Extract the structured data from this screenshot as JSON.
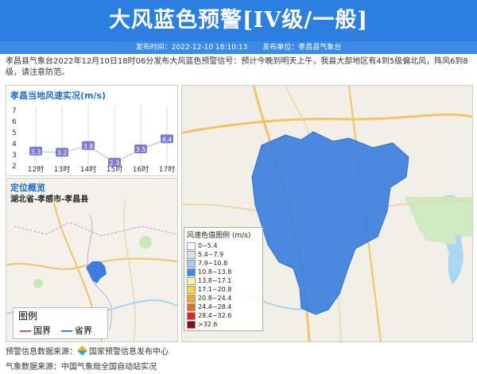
{
  "header": {
    "title": "大风蓝色预警[IV级/一般]",
    "publish_time_label": "发布时间：2022-12-10 18:10:13",
    "publisher_label": "发布单位：孝昌县气象台"
  },
  "description": "孝昌县气象台2022年12月10日18时06分发布大风蓝色预警信号：预计今晚到明天上午，我县大部地区有4到5级偏北风，阵风6到8级，请注意防范。",
  "wind_panel": {
    "title": "孝昌当地风速实况(m/s)",
    "y_ticks": [
      "7",
      "6",
      "5",
      "4",
      "3",
      "2"
    ],
    "labels": [
      "3.3",
      "3.2",
      "3.8",
      "2.3",
      "3.5",
      "4.4"
    ],
    "hours": [
      "12时",
      "13时",
      "14时",
      "15时",
      "16时",
      "17时"
    ]
  },
  "chart_data": {
    "type": "line",
    "title": "孝昌当地风速实况(m/s)",
    "categories": [
      "12时",
      "13时",
      "14时",
      "15时",
      "16时",
      "17时"
    ],
    "values": [
      3.3,
      3.2,
      3.8,
      2.3,
      3.5,
      4.4
    ],
    "ylim": [
      2,
      7
    ]
  },
  "location_panel": {
    "title": "定位概览",
    "region": "湖北省-孝感市-孝昌县",
    "legend_title": "图例",
    "legend_items": [
      "国界",
      "省界"
    ]
  },
  "main_map": {
    "legend_title": "风速色值图例 (m/s)",
    "legend": [
      {
        "label": "0~5.4",
        "color": "#ffffff"
      },
      {
        "label": "5.4~7.9",
        "color": "#cfe6f8"
      },
      {
        "label": "7.9~10.8",
        "color": "#9fcdf2"
      },
      {
        "label": "10.8~13.8",
        "color": "#3d8ae5"
      },
      {
        "label": "13.8~17.1",
        "color": "#fbf4a6"
      },
      {
        "label": "17.1~20.8",
        "color": "#f8d543"
      },
      {
        "label": "20.8~24.4",
        "color": "#f5a623"
      },
      {
        "label": "24.4~28.4",
        "color": "#ee6a1f"
      },
      {
        "label": "28.4~32.6",
        "color": "#d7291c"
      },
      {
        "label": ">32.6",
        "color": "#8b1016"
      }
    ]
  },
  "footer": {
    "warning_source_label": "预警信息数据来源：",
    "warning_source": "国家预警信息发布中心",
    "weather_source_label": "气象数据来源：",
    "weather_source": "中国气象局全国自动站实况"
  }
}
